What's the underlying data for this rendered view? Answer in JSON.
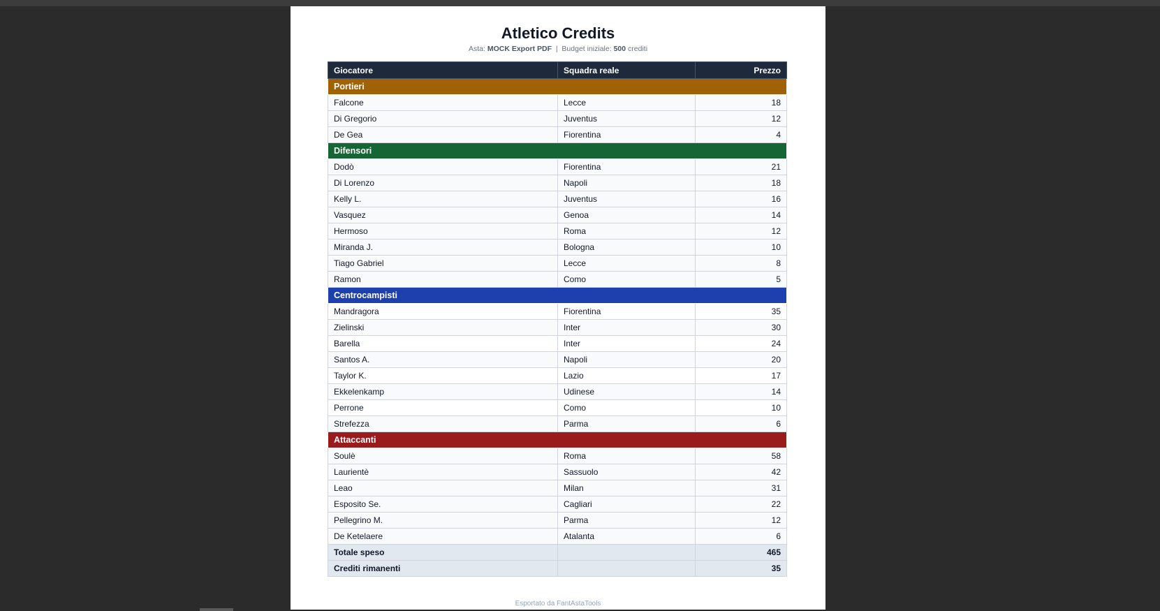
{
  "title": "Atletico Credits",
  "subtitle": {
    "asta_label": "Asta:",
    "asta_value": "MOCK Export PDF",
    "separator": "|",
    "budget_label": "Budget iniziale:",
    "budget_value": "500",
    "budget_unit": "crediti"
  },
  "table": {
    "headers": [
      "Giocatore",
      "Squadra reale",
      "Prezzo"
    ],
    "groups": [
      {
        "name": "Portieri",
        "color": "#a16207",
        "players": [
          {
            "name": "Falcone",
            "team": "Lecce",
            "price": "18"
          },
          {
            "name": "Di Gregorio",
            "team": "Juventus",
            "price": "12"
          },
          {
            "name": "De Gea",
            "team": "Fiorentina",
            "price": "4"
          }
        ]
      },
      {
        "name": "Difensori",
        "color": "#166534",
        "players": [
          {
            "name": "Dodò",
            "team": "Fiorentina",
            "price": "21"
          },
          {
            "name": "Di Lorenzo",
            "team": "Napoli",
            "price": "18"
          },
          {
            "name": "Kelly L.",
            "team": "Juventus",
            "price": "16"
          },
          {
            "name": "Vasquez",
            "team": "Genoa",
            "price": "14"
          },
          {
            "name": "Hermoso",
            "team": "Roma",
            "price": "12"
          },
          {
            "name": "Miranda J.",
            "team": "Bologna",
            "price": "10"
          },
          {
            "name": "Tiago Gabriel",
            "team": "Lecce",
            "price": "8"
          },
          {
            "name": "Ramon",
            "team": "Como",
            "price": "5"
          }
        ]
      },
      {
        "name": "Centrocampisti",
        "color": "#1e40af",
        "players": [
          {
            "name": "Mandragora",
            "team": "Fiorentina",
            "price": "35"
          },
          {
            "name": "Zielinski",
            "team": "Inter",
            "price": "30"
          },
          {
            "name": "Barella",
            "team": "Inter",
            "price": "24"
          },
          {
            "name": "Santos A.",
            "team": "Napoli",
            "price": "20"
          },
          {
            "name": "Taylor K.",
            "team": "Lazio",
            "price": "17"
          },
          {
            "name": "Ekkelenkamp",
            "team": "Udinese",
            "price": "14"
          },
          {
            "name": "Perrone",
            "team": "Como",
            "price": "10"
          },
          {
            "name": "Strefezza",
            "team": "Parma",
            "price": "6"
          }
        ]
      },
      {
        "name": "Attaccanti",
        "color": "#991b1b",
        "players": [
          {
            "name": "Soulè",
            "team": "Roma",
            "price": "58"
          },
          {
            "name": "Laurientè",
            "team": "Sassuolo",
            "price": "42"
          },
          {
            "name": "Leao",
            "team": "Milan",
            "price": "31"
          },
          {
            "name": "Esposito Se.",
            "team": "Cagliari",
            "price": "22"
          },
          {
            "name": "Pellegrino M.",
            "team": "Parma",
            "price": "12"
          },
          {
            "name": "De Ketelaere",
            "team": "Atalanta",
            "price": "6"
          }
        ]
      }
    ],
    "totals": [
      {
        "label": "Totale speso",
        "value": "465"
      },
      {
        "label": "Crediti rimanenti",
        "value": "35"
      }
    ]
  },
  "footer": "Esportato da FantAstaTools"
}
